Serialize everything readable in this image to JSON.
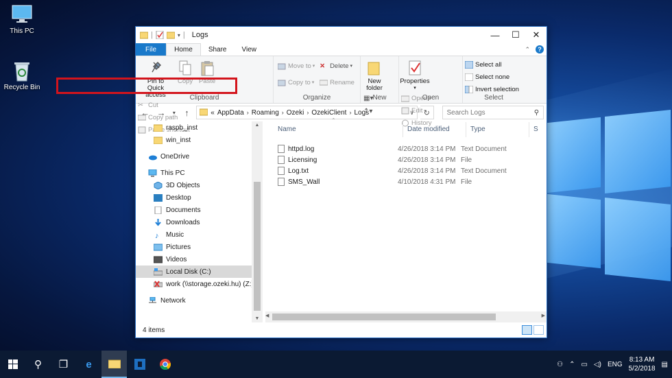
{
  "desktop": {
    "icons": [
      {
        "label": "This PC",
        "icon": "this-pc-icon"
      },
      {
        "label": "Recycle Bin",
        "icon": "recycle-bin-icon"
      }
    ]
  },
  "window": {
    "title": "Logs",
    "controls": {
      "minimize": "—",
      "maximize": "☐",
      "close": "✕"
    }
  },
  "ribbon": {
    "tabs": [
      "File",
      "Home",
      "Share",
      "View"
    ],
    "active_tab": "Home",
    "clipboard": {
      "pin": "Pin to Quick access",
      "copy": "Copy",
      "paste": "Paste",
      "cut": "Cut",
      "copy_path": "Copy path",
      "paste_shortcut": "Paste shortcut",
      "label": "Clipboard"
    },
    "organize": {
      "move_to": "Move to",
      "copy_to": "Copy to",
      "delete": "Delete",
      "rename": "Rename",
      "label": "Organize"
    },
    "new": {
      "new_folder": "New folder",
      "label": "New"
    },
    "open": {
      "properties": "Properties",
      "open": "Open",
      "edit": "Edit",
      "history": "History",
      "label": "Open"
    },
    "select": {
      "select_all": "Select all",
      "select_none": "Select none",
      "invert": "Invert selection",
      "label": "Select"
    }
  },
  "address": {
    "prefix": "«",
    "crumbs": [
      "AppData",
      "Roaming",
      "Ozeki",
      "OzekiClient",
      "Logs"
    ],
    "search_placeholder": "Search Logs"
  },
  "nav": {
    "items": [
      {
        "label": "raspb_inst",
        "icon": "folder-icon",
        "level": 1
      },
      {
        "label": "win_inst",
        "icon": "folder-icon",
        "level": 1
      },
      {
        "label": "OneDrive",
        "icon": "onedrive-icon",
        "level": 0
      },
      {
        "label": "This PC",
        "icon": "this-pc-icon",
        "level": 0
      },
      {
        "label": "3D Objects",
        "icon": "3d-objects-icon",
        "level": 1
      },
      {
        "label": "Desktop",
        "icon": "desktop-icon",
        "level": 1
      },
      {
        "label": "Documents",
        "icon": "documents-icon",
        "level": 1
      },
      {
        "label": "Downloads",
        "icon": "downloads-icon",
        "level": 1
      },
      {
        "label": "Music",
        "icon": "music-icon",
        "level": 1
      },
      {
        "label": "Pictures",
        "icon": "pictures-icon",
        "level": 1
      },
      {
        "label": "Videos",
        "icon": "videos-icon",
        "level": 1
      },
      {
        "label": "Local Disk (C:)",
        "icon": "local-disk-icon",
        "level": 1,
        "selected": true
      },
      {
        "label": "work (\\\\storage.ozeki.hu) (Z:)",
        "icon": "network-drive-icon",
        "level": 1
      },
      {
        "label": "Network",
        "icon": "network-icon",
        "level": 0
      }
    ]
  },
  "files": {
    "columns": [
      "Name",
      "Date modified",
      "Type",
      "S"
    ],
    "rows": [
      {
        "name": "httpd.log",
        "date": "4/26/2018 3:14 PM",
        "type": "Text Document"
      },
      {
        "name": "Licensing",
        "date": "4/26/2018 3:14 PM",
        "type": "File"
      },
      {
        "name": "Log.txt",
        "date": "4/26/2018 3:14 PM",
        "type": "Text Document"
      },
      {
        "name": "SMS_Wall",
        "date": "4/10/2018 4:31 PM",
        "type": "File"
      }
    ]
  },
  "status": {
    "count": "4 items"
  },
  "taskbar": {
    "lang": "ENG",
    "time": "8:13 AM",
    "date": "5/2/2018"
  },
  "colors": {
    "accent": "#1979ca",
    "highlight": "#d3141c",
    "folder": "#f8d775"
  }
}
